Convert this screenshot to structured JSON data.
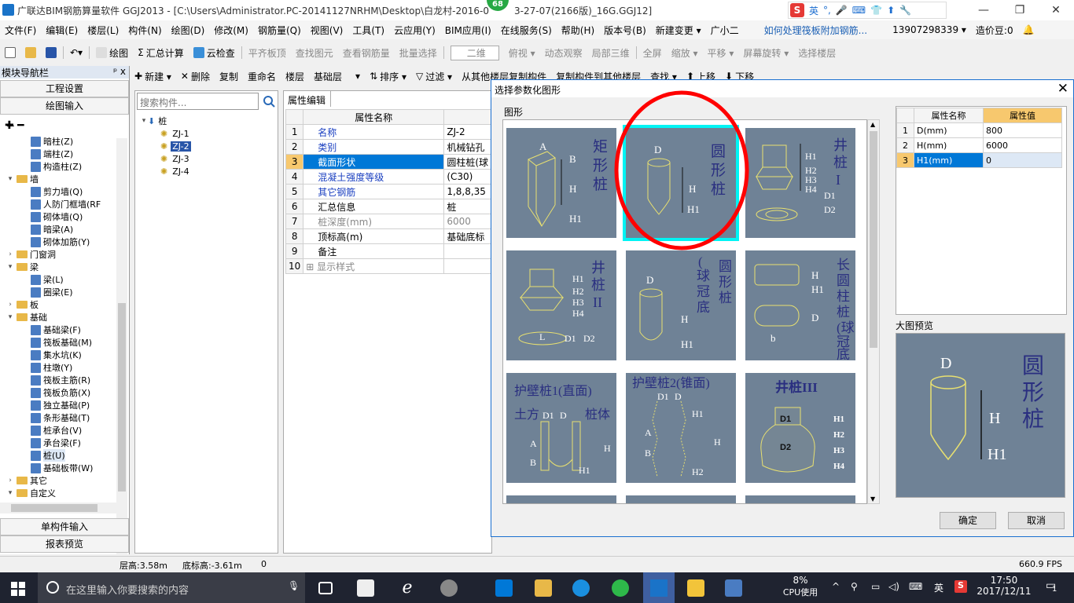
{
  "window": {
    "title": "广联达BIM钢筋算量软件 GGJ2013 - [C:\\Users\\Administrator.PC-20141127NRHM\\Desktop\\白龙村-2016-0",
    "title_suffix": "3-27-07(2166版)_16G.GGJ12]",
    "badge": "68"
  },
  "ime": {
    "logo": "S",
    "lang": "英",
    "icons": [
      "°,",
      "🎤",
      "⌨",
      "👕",
      "⬆",
      "🔧"
    ]
  },
  "menu": [
    "文件(F)",
    "编辑(E)",
    "楼层(L)",
    "构件(N)",
    "绘图(D)",
    "修改(M)",
    "钢筋量(Q)",
    "视图(V)",
    "工具(T)",
    "云应用(Y)",
    "BIM应用(I)",
    "在线服务(S)",
    "帮助(H)",
    "版本号(B)",
    "新建变更 ▾",
    "广小二",
    "如何处理筏板附加钢筋...",
    "13907298339 ▾",
    "造价豆:0",
    "🔔"
  ],
  "toolbar1": [
    "绘图",
    "汇总计算",
    "云检查",
    "平齐板顶",
    "查找图元",
    "查看钢筋量",
    "批量选择",
    "二维",
    "俯视 ▾",
    "动态观察",
    "局部三维",
    "全屏",
    "缩放 ▾",
    "平移 ▾",
    "屏幕旋转 ▾",
    "选择楼层"
  ],
  "toolbar2": [
    "新建 ▾",
    "删除",
    "复制",
    "重命名",
    "楼层",
    "基础层",
    "▾",
    "排序 ▾",
    "过滤 ▾",
    "从其他楼层复制构件",
    "复制构件到其他楼层",
    "查找 ▾",
    "上移",
    "下移"
  ],
  "leftnav": {
    "header": "模块导航栏",
    "pin": "ᵖ x",
    "btn_project": "工程设置",
    "btn_draw": "绘图输入",
    "btn_single": "单构件输入",
    "btn_report": "报表预览",
    "tree": [
      {
        "label": "暗柱(Z)",
        "level": 2
      },
      {
        "label": "端柱(Z)",
        "level": 2
      },
      {
        "label": "构造柱(Z)",
        "level": 2
      },
      {
        "label": "墙",
        "level": 0,
        "folder": true,
        "open": true
      },
      {
        "label": "剪力墙(Q)",
        "level": 2
      },
      {
        "label": "人防门框墙(RF",
        "level": 2
      },
      {
        "label": "砌体墙(Q)",
        "level": 2
      },
      {
        "label": "暗梁(A)",
        "level": 2
      },
      {
        "label": "砌体加筋(Y)",
        "level": 2
      },
      {
        "label": "门窗洞",
        "level": 0,
        "folder": true,
        "open": false
      },
      {
        "label": "梁",
        "level": 0,
        "folder": true,
        "open": true
      },
      {
        "label": "梁(L)",
        "level": 2
      },
      {
        "label": "圈梁(E)",
        "level": 2
      },
      {
        "label": "板",
        "level": 0,
        "folder": true,
        "open": false
      },
      {
        "label": "基础",
        "level": 0,
        "folder": true,
        "open": true
      },
      {
        "label": "基础梁(F)",
        "level": 2
      },
      {
        "label": "筏板基础(M)",
        "level": 2
      },
      {
        "label": "集水坑(K)",
        "level": 2
      },
      {
        "label": "柱墩(Y)",
        "level": 2
      },
      {
        "label": "筏板主筋(R)",
        "level": 2
      },
      {
        "label": "筏板负筋(X)",
        "level": 2
      },
      {
        "label": "独立基础(P)",
        "level": 2
      },
      {
        "label": "条形基础(T)",
        "level": 2
      },
      {
        "label": "桩承台(V)",
        "level": 2
      },
      {
        "label": "承台梁(F)",
        "level": 2
      },
      {
        "label": "桩(U)",
        "level": 2,
        "selected": true
      },
      {
        "label": "基础板带(W)",
        "level": 2
      },
      {
        "label": "其它",
        "level": 0,
        "folder": true,
        "open": false
      },
      {
        "label": "自定义",
        "level": 0,
        "folder": true,
        "open": true
      }
    ]
  },
  "comp": {
    "search_placeholder": "搜索构件...",
    "root": "桩",
    "items": [
      "ZJ-1",
      "ZJ-2",
      "ZJ-3",
      "ZJ-4"
    ],
    "selected": "ZJ-2"
  },
  "prop": {
    "tab": "属性编辑",
    "col_name": "属性名称",
    "rows": [
      {
        "n": "1",
        "name": "名称",
        "val": "ZJ-2",
        "blue": true
      },
      {
        "n": "2",
        "name": "类别",
        "val": "机械钻孔",
        "blue": true
      },
      {
        "n": "3",
        "name": "截面形状",
        "val": "圆柱桩(球",
        "blue": true,
        "selected": true
      },
      {
        "n": "4",
        "name": "混凝土强度等级",
        "val": "(C30)",
        "blue": true
      },
      {
        "n": "5",
        "name": "其它钢筋",
        "val": "1,8,8,35",
        "blue": true
      },
      {
        "n": "6",
        "name": "汇总信息",
        "val": "桩"
      },
      {
        "n": "7",
        "name": "桩深度(mm)",
        "val": "6000",
        "gray": true
      },
      {
        "n": "8",
        "name": "顶标高(m)",
        "val": "基础底标"
      },
      {
        "n": "9",
        "name": "备注",
        "val": ""
      },
      {
        "n": "10",
        "name": "显示样式",
        "val": "",
        "expand": true
      }
    ]
  },
  "dialog": {
    "title": "选择参数化图形",
    "shape_label": "图形",
    "preview_label": "大图预览",
    "ok": "确定",
    "cancel": "取消",
    "attr_header_name": "属性名称",
    "attr_header_val": "属性值",
    "attrs": [
      {
        "n": "1",
        "name": "D(mm)",
        "val": "800"
      },
      {
        "n": "2",
        "name": "H(mm)",
        "val": "6000"
      },
      {
        "n": "3",
        "name": "H1(mm)",
        "val": "0",
        "selected": true
      }
    ],
    "shapes": [
      {
        "title": "矩形桩"
      },
      {
        "title": "圆形桩",
        "selected": true
      },
      {
        "title": "井桩I"
      },
      {
        "title": "井桩II"
      },
      {
        "title": "圆形桩(球冠底)"
      },
      {
        "title": "长圆柱桩(球冠底)"
      },
      {
        "title": "护壁桩1(直面)"
      },
      {
        "title": "护壁桩2(锥面)"
      },
      {
        "title": "井桩III"
      }
    ],
    "dim": {
      "A": "A",
      "B": "B",
      "D": "D",
      "H": "H",
      "H1": "H1",
      "H2": "H2",
      "H3": "H3",
      "H4": "H4",
      "D1": "D1",
      "D2": "D2",
      "L": "L",
      "b": "b",
      "tufang": "土方",
      "zhuti": "桩体"
    },
    "preview_title": "圆形桩"
  },
  "status": {
    "floor_height": "层高:3.58m",
    "bottom_elev": "底标高:-3.61m",
    "z": "0",
    "fps": "660.9 FPS"
  },
  "taskbar": {
    "search": "在这里输入你要搜索的内容",
    "cpu_pct": "8%",
    "cpu_label": "CPU使用",
    "lang": "英",
    "time": "17:50",
    "date": "2017/12/11",
    "notif": "1"
  },
  "colors": {
    "accent": "#0078d7",
    "selected_row": "#0078d7",
    "card_bg": "#6f8296",
    "card_sel": "#00f4f4",
    "annotation": "#ff0000"
  }
}
